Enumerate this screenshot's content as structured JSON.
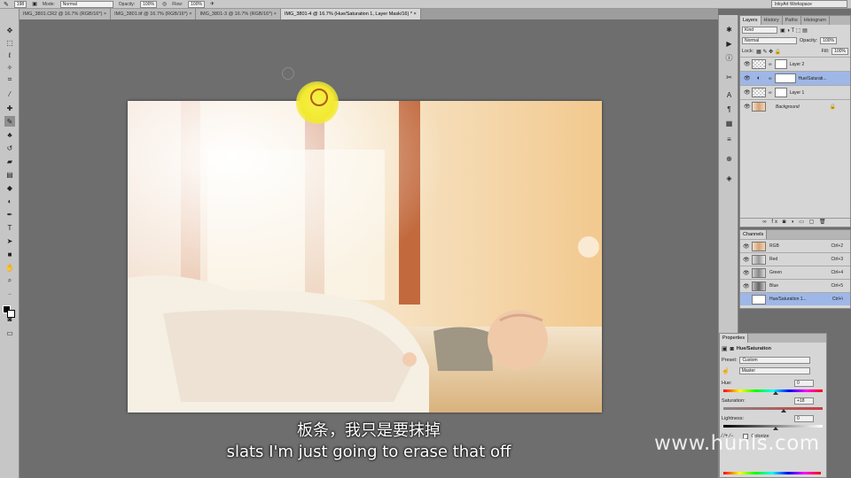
{
  "options_bar": {
    "brush_size": "198",
    "mode_label": "Mode:",
    "mode_value": "Normal",
    "opacity_label": "Opacity:",
    "opacity_value": "100%",
    "flow_label": "Flow:",
    "flow_value": "100%",
    "workspace": "InkyArt Workspace"
  },
  "tabs": [
    {
      "label": "IMG_3801.CR2 @ 16.7% (RGB/16*)"
    },
    {
      "label": "IMG_3801.tif @ 16.7% (RGB/16*)"
    },
    {
      "label": "IMG_3801-3 @ 16.7% (RGB/16*)"
    },
    {
      "label": "IMG_3801-4 @ 16.7% (Hue/Saturation 1, Layer Mask/16) *"
    }
  ],
  "layers_panel": {
    "tabs": [
      "Layers",
      "History",
      "Paths",
      "Histogram"
    ],
    "kind": "Kind",
    "blend": "Normal",
    "opacity_label": "Opacity:",
    "opacity_value": "100%",
    "lock_label": "Lock:",
    "fill_label": "Fill:",
    "fill_value": "100%",
    "layers": [
      {
        "name": "Layer 2"
      },
      {
        "name": "Hue/Saturati..."
      },
      {
        "name": "Layer 1"
      },
      {
        "name": "Background"
      }
    ]
  },
  "channels_panel": {
    "title": "Channels",
    "channels": [
      {
        "name": "RGB",
        "key": "Ctrl+2"
      },
      {
        "name": "Red",
        "key": "Ctrl+3"
      },
      {
        "name": "Green",
        "key": "Ctrl+4"
      },
      {
        "name": "Blue",
        "key": "Ctrl+5"
      },
      {
        "name": "Hue/Saturation 1...",
        "key": "Ctrl+\\"
      }
    ]
  },
  "properties_panel": {
    "title": "Properties",
    "adjustment": "Hue/Saturation",
    "preset_label": "Preset:",
    "preset_value": "Custom",
    "channel_value": "Master",
    "hue_label": "Hue:",
    "hue_value": "0",
    "saturation_label": "Saturation:",
    "saturation_value": "+18",
    "lightness_label": "Lightness:",
    "lightness_value": "0",
    "colorize_label": "Colorize"
  },
  "subtitles": {
    "chinese": "板条，我只是要抹掉",
    "english": "slats I'm just going to erase that off"
  },
  "watermark": "www.hunls.com"
}
